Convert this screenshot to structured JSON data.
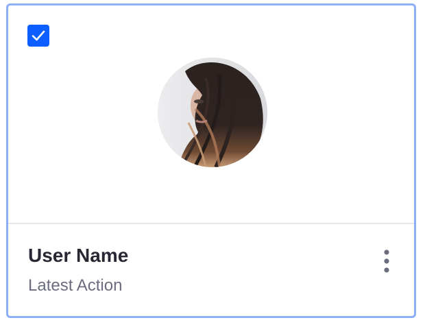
{
  "card": {
    "selected": true,
    "title": "User Name",
    "subtitle": "Latest Action",
    "avatar_icon": "user-photo",
    "menu_icon": "vertical-ellipsis-icon"
  },
  "colors": {
    "border_selected": "#8bb0f7",
    "checkbox_fill": "#0b5fff",
    "title_text": "#272833",
    "subtitle_text": "#6b6c7e",
    "divider": "#e7e7ed"
  }
}
